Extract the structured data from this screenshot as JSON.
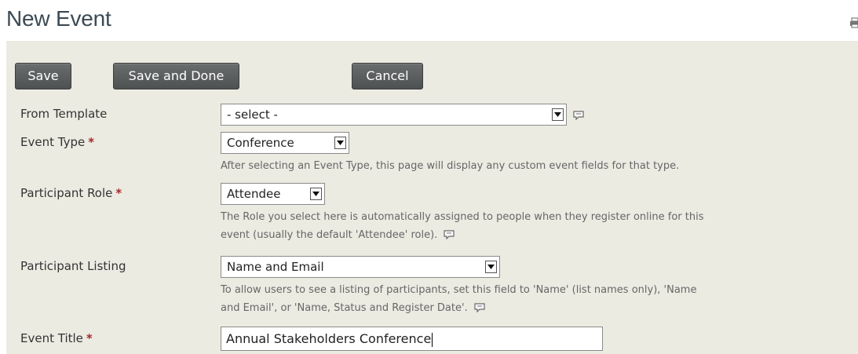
{
  "header": {
    "title": "New Event"
  },
  "toolbar": {
    "save_label": "Save",
    "save_done_label": "Save and Done",
    "cancel_label": "Cancel"
  },
  "form": {
    "from_template": {
      "label": "From Template",
      "value": "- select -"
    },
    "event_type": {
      "label": "Event Type",
      "required_mark": "*",
      "value": "Conference",
      "help": "After selecting an Event Type, this page will display any custom event fields for that type."
    },
    "participant_role": {
      "label": "Participant Role",
      "required_mark": "*",
      "value": "Attendee",
      "help_line1": "The Role you select here is automatically assigned to people when they register online for this",
      "help_line2": "event (usually the default 'Attendee' role)."
    },
    "participant_listing": {
      "label": "Participant Listing",
      "value": "Name and Email",
      "help_line1": "To allow users to see a listing of participants, set this field to 'Name' (list names only), 'Name",
      "help_line2": "and Email', or 'Name, Status and Register Date'."
    },
    "event_title": {
      "label": "Event Title",
      "required_mark": "*",
      "value": "Annual Stakeholders Conference"
    }
  },
  "icons": {
    "help": "help-bubble-icon",
    "print": "print-icon",
    "dropdown": "chevron-down-icon"
  },
  "colors": {
    "panel_bg": "#ecebe2",
    "button_bg": "#5a5d5e",
    "required": "#a52a2a",
    "title": "#3d4a53"
  }
}
